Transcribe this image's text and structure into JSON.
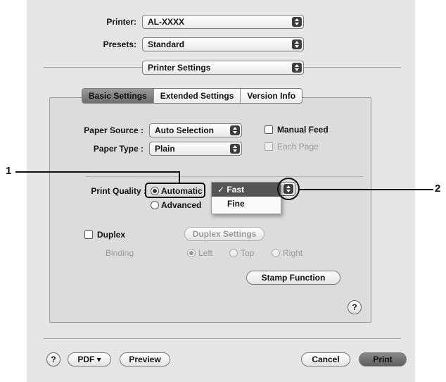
{
  "header": {
    "printer_label": "Printer:",
    "printer_value": "AL-XXXX",
    "presets_label": "Presets:",
    "presets_value": "Standard",
    "pane_value": "Printer Settings"
  },
  "tabs": [
    {
      "label": "Basic Settings",
      "selected": true
    },
    {
      "label": "Extended Settings",
      "selected": false
    },
    {
      "label": "Version Info",
      "selected": false
    }
  ],
  "paper": {
    "source_label": "Paper Source :",
    "source_value": "Auto Selection",
    "type_label": "Paper Type :",
    "type_value": "Plain",
    "manual_feed_label": "Manual Feed",
    "each_page_label": "Each Page"
  },
  "quality": {
    "label": "Print Quality :",
    "automatic_label": "Automatic",
    "advanced_label": "Advanced",
    "menu_items": [
      "✓ Fast",
      "Fine"
    ]
  },
  "duplex": {
    "label": "Duplex",
    "settings_button": "Duplex Settings",
    "binding_label": "Binding",
    "left_label": "Left",
    "top_label": "Top",
    "right_label": "Right"
  },
  "stamp_button": "Stamp Function",
  "footer": {
    "help": "?",
    "pdf_button": "PDF ▾",
    "preview_button": "Preview",
    "cancel_button": "Cancel",
    "print_button": "Print"
  },
  "callouts": {
    "one": "1",
    "two": "2"
  },
  "icons": {
    "popup": "up-down-arrows-icon",
    "help": "help-icon"
  }
}
